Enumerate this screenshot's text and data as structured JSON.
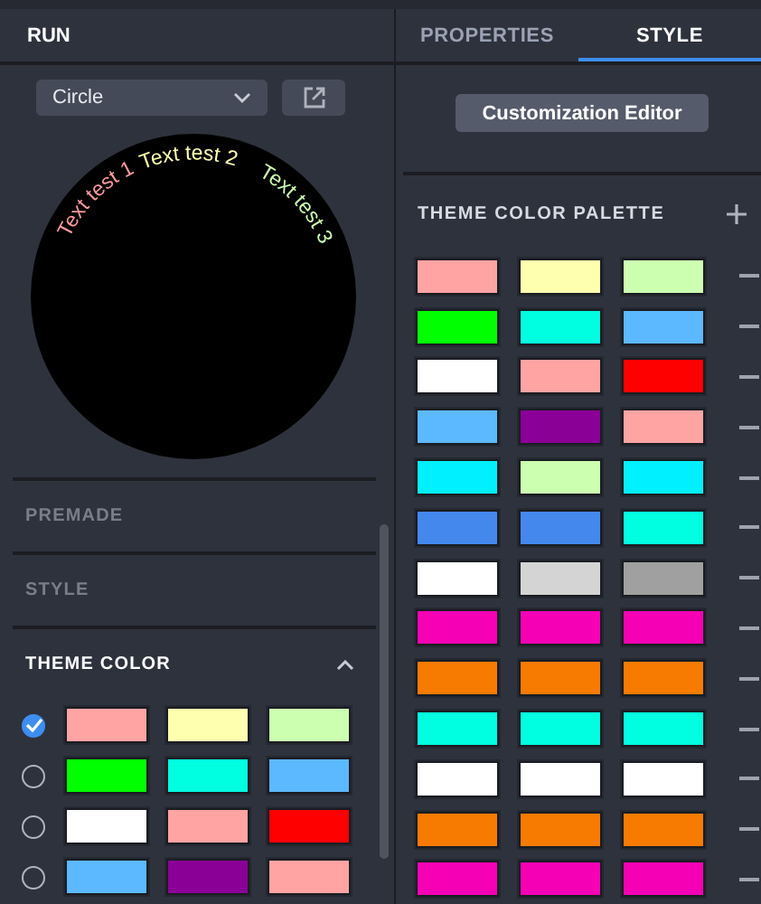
{
  "left_panel": {
    "title": "RUN",
    "shape_select": {
      "value": "Circle"
    },
    "preview": {
      "texts": [
        {
          "text": "Text test 1",
          "color": "#ff9a9a"
        },
        {
          "text": "Text test 2",
          "color": "#ffffb0"
        },
        {
          "text": "Text test 3",
          "color": "#ccffb0"
        }
      ]
    },
    "sections": [
      {
        "title": "PREMADE",
        "expanded": false
      },
      {
        "title": "STYLE",
        "expanded": false
      },
      {
        "title": "THEME COLOR",
        "expanded": true,
        "options": [
          {
            "selected": true,
            "colors": [
              {
                "color": "#ffa3a3"
              },
              {
                "color": "#ffffb0"
              },
              {
                "color": "#ccffb0"
              }
            ]
          },
          {
            "selected": false,
            "colors": [
              {
                "color": "#00ff00"
              },
              {
                "color": "#00ffe0"
              },
              {
                "color": "#5cb8ff"
              }
            ]
          },
          {
            "selected": false,
            "colors": [
              {
                "color": "#ffffff"
              },
              {
                "color": "#ffa3a3"
              },
              {
                "color": "#ff0000"
              }
            ]
          },
          {
            "selected": false,
            "colors": [
              {
                "color": "#5cb8ff"
              },
              {
                "color": "#8a0096"
              },
              {
                "color": "#ffa3a3"
              }
            ]
          }
        ]
      }
    ]
  },
  "right_panel": {
    "tabs": [
      {
        "label": "PROPERTIES",
        "selected": false
      },
      {
        "label": "STYLE",
        "selected": true
      }
    ],
    "editor_button": "Customization Editor",
    "palette": {
      "title": "THEME COLOR PALETTE",
      "rows": [
        {
          "colors": [
            {
              "color": "#ffa3a3"
            },
            {
              "color": "#ffffb0"
            },
            {
              "color": "#ccffb0"
            }
          ]
        },
        {
          "colors": [
            {
              "color": "#00ff00"
            },
            {
              "color": "#00ffe0"
            },
            {
              "color": "#5cb8ff"
            }
          ]
        },
        {
          "colors": [
            {
              "color": "#ffffff"
            },
            {
              "color": "#ffa3a3"
            },
            {
              "color": "#ff0000"
            }
          ]
        },
        {
          "colors": [
            {
              "color": "#5cb8ff"
            },
            {
              "color": "#8a0096"
            },
            {
              "color": "#ffa3a3"
            }
          ]
        },
        {
          "colors": [
            {
              "color": "#00f0ff"
            },
            {
              "color": "#ccffb0"
            },
            {
              "color": "#00f0ff"
            }
          ]
        },
        {
          "colors": [
            {
              "color": "#4488ee"
            },
            {
              "color": "#4488ee"
            },
            {
              "color": "#00ffe0"
            }
          ]
        },
        {
          "colors": [
            {
              "color": "#ffffff"
            },
            {
              "color": "#d4d4d4"
            },
            {
              "color": "#a0a0a0"
            }
          ]
        },
        {
          "colors": [
            {
              "color": "#f500b4"
            },
            {
              "color": "#f500b4"
            },
            {
              "color": "#f500b4"
            }
          ]
        },
        {
          "colors": [
            {
              "color": "#f77b00"
            },
            {
              "color": "#f77b00"
            },
            {
              "color": "#f77b00"
            }
          ]
        },
        {
          "colors": [
            {
              "color": "#00ffe0"
            },
            {
              "color": "#00ffe0"
            },
            {
              "color": "#00ffe0"
            }
          ]
        },
        {
          "colors": [
            {
              "color": "#ffffff"
            },
            {
              "color": "#ffffff"
            },
            {
              "color": "#ffffff"
            }
          ]
        },
        {
          "colors": [
            {
              "color": "#f77b00"
            },
            {
              "color": "#f77b00"
            },
            {
              "color": "#f77b00"
            }
          ]
        },
        {
          "colors": [
            {
              "color": "#f500b4"
            },
            {
              "color": "#f500b4"
            },
            {
              "color": "#f500b4"
            }
          ]
        }
      ]
    }
  }
}
